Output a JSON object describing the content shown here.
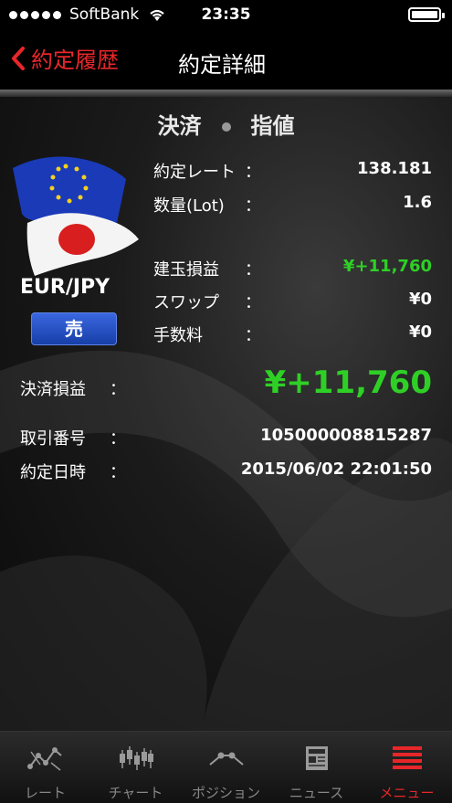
{
  "status_bar": {
    "carrier": "SoftBank",
    "time": "23:35"
  },
  "nav": {
    "back_label": "約定履歴",
    "title": "約定詳細"
  },
  "heading": {
    "left": "決済",
    "right": "指値"
  },
  "pair": {
    "name": "EUR/JPY",
    "side": "売"
  },
  "details": {
    "rate_label": "約定レート",
    "rate_value": "138.181",
    "qty_label": "数量(Lot)",
    "qty_value": "1.6",
    "pl_label": "建玉損益",
    "pl_value": "¥+11,760",
    "swap_label": "スワップ",
    "swap_value": "¥0",
    "fee_label": "手数料",
    "fee_value": "¥0",
    "settle_label": "決済損益",
    "settle_value": "¥+11,760",
    "trade_no_label": "取引番号",
    "trade_no_value": "105000008815287",
    "date_label": "約定日時",
    "date_value": "2015/06/02 22:01:50",
    "colon": "："
  },
  "tabs": [
    {
      "label": "レート",
      "icon": "rate-icon"
    },
    {
      "label": "チャート",
      "icon": "candlestick-icon"
    },
    {
      "label": "ポジション",
      "icon": "position-icon"
    },
    {
      "label": "ニュース",
      "icon": "news-icon"
    },
    {
      "label": "メニュー",
      "icon": "menu-icon"
    }
  ],
  "colors": {
    "accent": "#e8262a",
    "profit": "#2fd026",
    "sell": "#1f4fcf"
  }
}
